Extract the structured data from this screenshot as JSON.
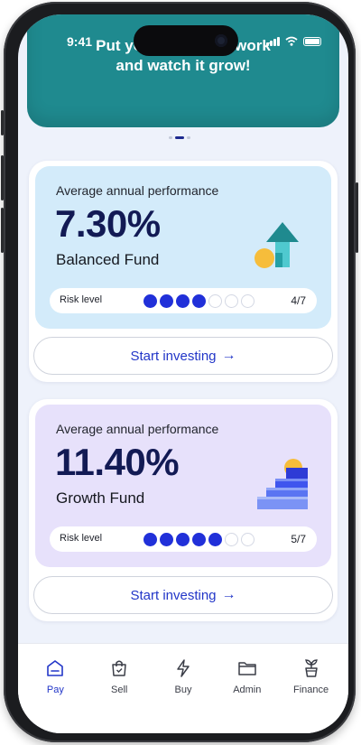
{
  "banner": {
    "text": "Put your money to work\nand watch it grow!",
    "color": "#1f8a8f"
  },
  "status_bar": {
    "time": "9:41"
  },
  "carousel": {
    "active_index": 1,
    "count": 3
  },
  "funds": [
    {
      "perf_label": "Average annual performance",
      "perf_value": "7.30%",
      "name": "Balanced Fund",
      "risk_label": "Risk level",
      "risk_level": 4,
      "risk_max": 7,
      "risk_text": "4/7",
      "bg_color": "#d3ebfa",
      "icon": "arrow-up-coin-icon",
      "cta_label": "Start investing",
      "cta_icon": "arrow-right-icon"
    },
    {
      "perf_label": "Average annual performance",
      "perf_value": "11.40%",
      "name": "Growth Fund",
      "risk_label": "Risk level",
      "risk_level": 5,
      "risk_max": 7,
      "risk_text": "5/7",
      "bg_color": "#e7e1fb",
      "icon": "stairs-sun-icon",
      "cta_label": "Start investing",
      "cta_icon": "arrow-right-icon"
    }
  ],
  "bottom_nav": [
    {
      "label": "Pay",
      "icon": "home-icon",
      "active": true
    },
    {
      "label": "Sell",
      "icon": "shopping-bag-icon",
      "active": false
    },
    {
      "label": "Buy",
      "icon": "lightning-icon",
      "active": false
    },
    {
      "label": "Admin",
      "icon": "folder-icon",
      "active": false
    },
    {
      "label": "Finance",
      "icon": "plant-pot-icon",
      "active": false
    }
  ],
  "colors": {
    "accent": "#2236c8",
    "risk_dot": "#2130d9",
    "heading": "#121a54"
  }
}
